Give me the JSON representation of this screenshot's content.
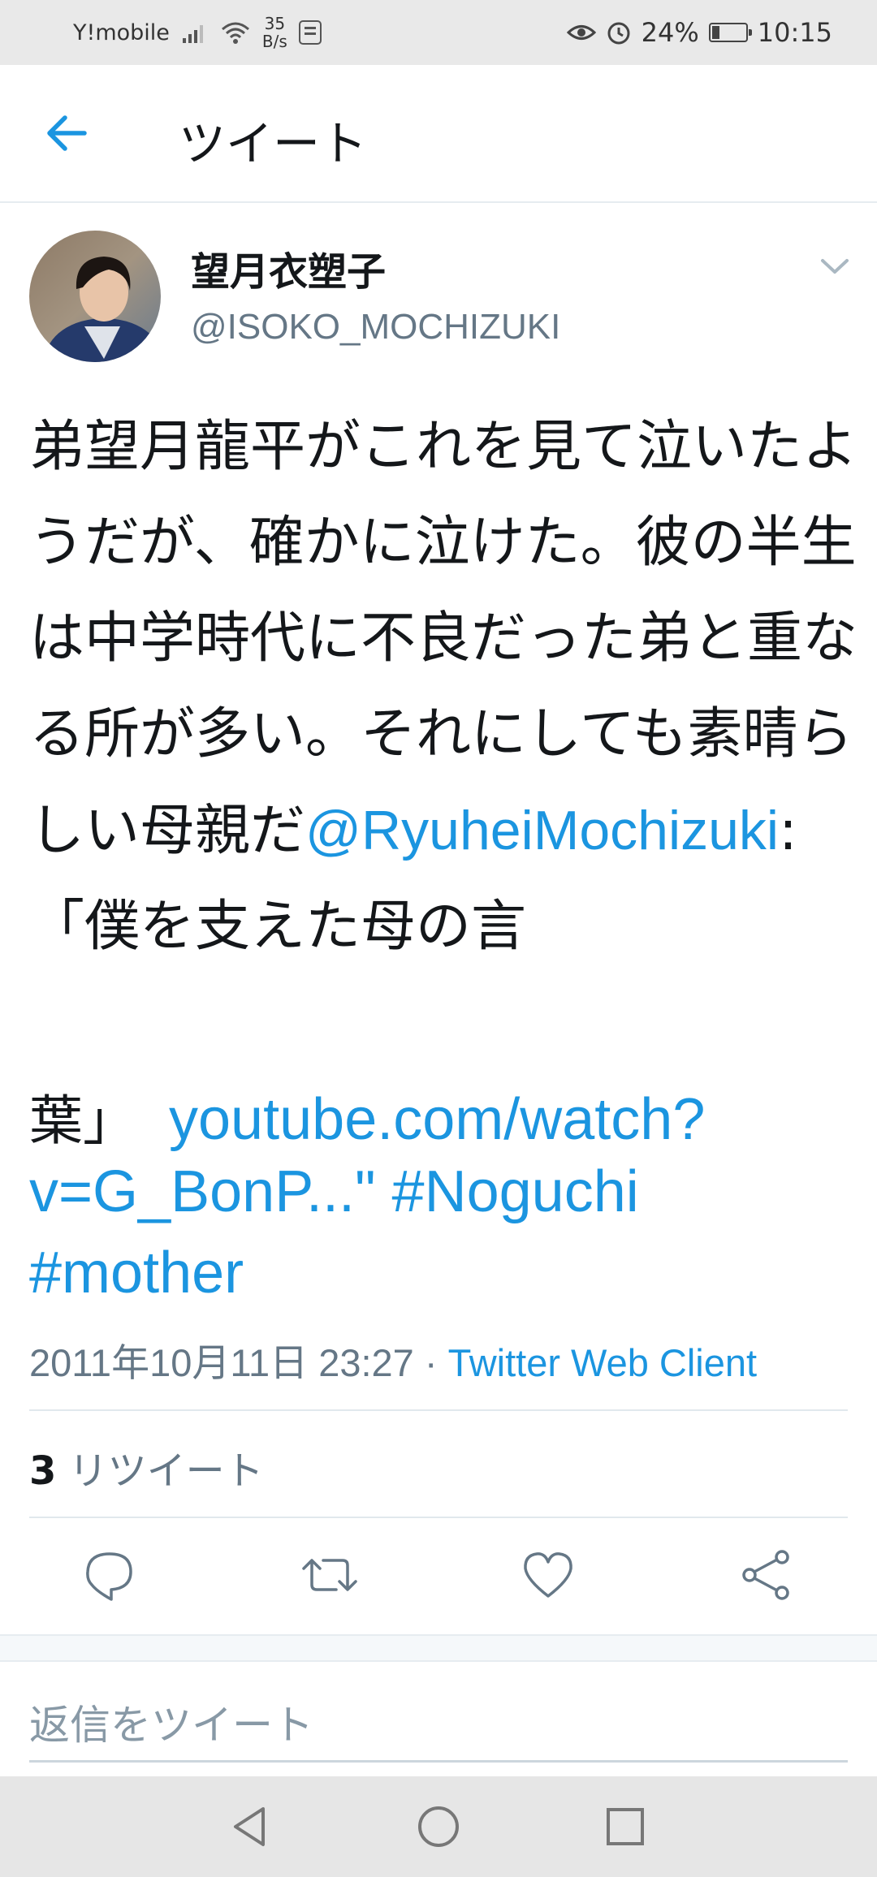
{
  "status_bar": {
    "carrier": "Y!mobile",
    "speed_value": "35",
    "speed_unit": "B/s",
    "battery_pct": "24%",
    "battery_level": 0.24,
    "time": "10:15"
  },
  "header": {
    "title": "ツイート"
  },
  "tweet": {
    "name": "望月衣塑子",
    "handle": "@ISOKO_MOCHIZUKI",
    "text_main": "弟望月龍平がこれを見て泣いたようだが、確かに泣けた。彼の半生は中学時代に不良だった弟と重なる所が多い。それにしても素晴らしい母親だ",
    "mention": "@RyuheiMochizuki",
    "text_colon": ":",
    "text_quote_1": "「僕を支えた母の言",
    "text_quote_2": "葉」",
    "url_part1": "youtube.com/watch?",
    "url_part2": "v=G_BonP...\"",
    "hashtag1": "#Noguchi",
    "hashtag2": "#mother",
    "timestamp": "2011年10月11日 23:27",
    "separator": " · ",
    "client": "Twitter Web Client"
  },
  "stats": {
    "retweet_count": "3",
    "retweet_label": " リツイート"
  },
  "actions": [
    "reply-icon",
    "retweet-icon",
    "like-icon",
    "share-icon"
  ],
  "reply": {
    "placeholder": "返信をツイート"
  },
  "colors": {
    "link": "#1b95e0",
    "text": "#14171a",
    "muted": "#657786"
  }
}
